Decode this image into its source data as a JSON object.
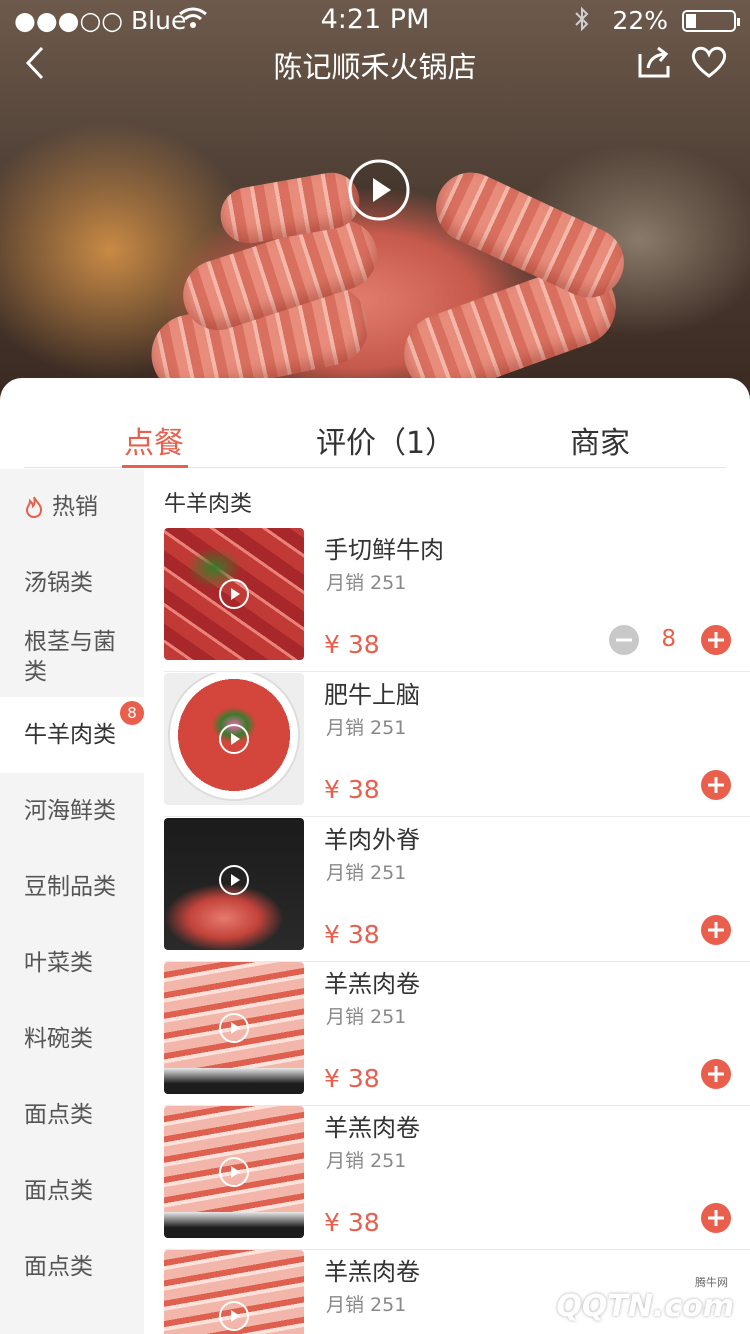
{
  "status_bar": {
    "carrier": "●●●○○ Blue",
    "time": "4:21 PM",
    "battery": "22%"
  },
  "nav": {
    "title": "陈记顺禾火锅店"
  },
  "tabs": [
    {
      "label": "点餐",
      "active": true
    },
    {
      "label": "评价（1）",
      "active": false
    },
    {
      "label": "商家",
      "active": false
    }
  ],
  "sidebar": {
    "items": [
      {
        "label": "热销",
        "icon": "flame-icon"
      },
      {
        "label": "汤锅类"
      },
      {
        "label": "根茎与菌类"
      },
      {
        "label": "牛羊肉类",
        "active": true,
        "badge": "8"
      },
      {
        "label": "河海鲜类"
      },
      {
        "label": "豆制品类"
      },
      {
        "label": "叶菜类"
      },
      {
        "label": "料碗类"
      },
      {
        "label": "面点类"
      },
      {
        "label": "面点类"
      },
      {
        "label": "面点类"
      }
    ]
  },
  "section": {
    "title": "牛羊肉类"
  },
  "menu_items": [
    {
      "name": "手切鲜牛肉",
      "sales": "月销 251",
      "price": "¥ 38",
      "qty": "8",
      "thumb": "raw"
    },
    {
      "name": "肥牛上脑",
      "sales": "月销 251",
      "price": "¥ 38",
      "thumb": "plate"
    },
    {
      "name": "羊肉外脊",
      "sales": "月销 251",
      "price": "¥ 38",
      "thumb": "dark"
    },
    {
      "name": "羊羔肉卷",
      "sales": "月销 251",
      "price": "¥ 38",
      "thumb": "rolls"
    },
    {
      "name": "羊羔肉卷",
      "sales": "月销 251",
      "price": "¥ 38",
      "thumb": "rolls"
    },
    {
      "name": "羊羔肉卷",
      "sales": "月销 251",
      "price": "",
      "thumb": "rolls"
    }
  ],
  "watermark": {
    "text": "QQTN.com",
    "small": "腾牛网"
  },
  "colors": {
    "accent": "#e95f4c",
    "sidebar_bg": "#f4f4f4"
  }
}
